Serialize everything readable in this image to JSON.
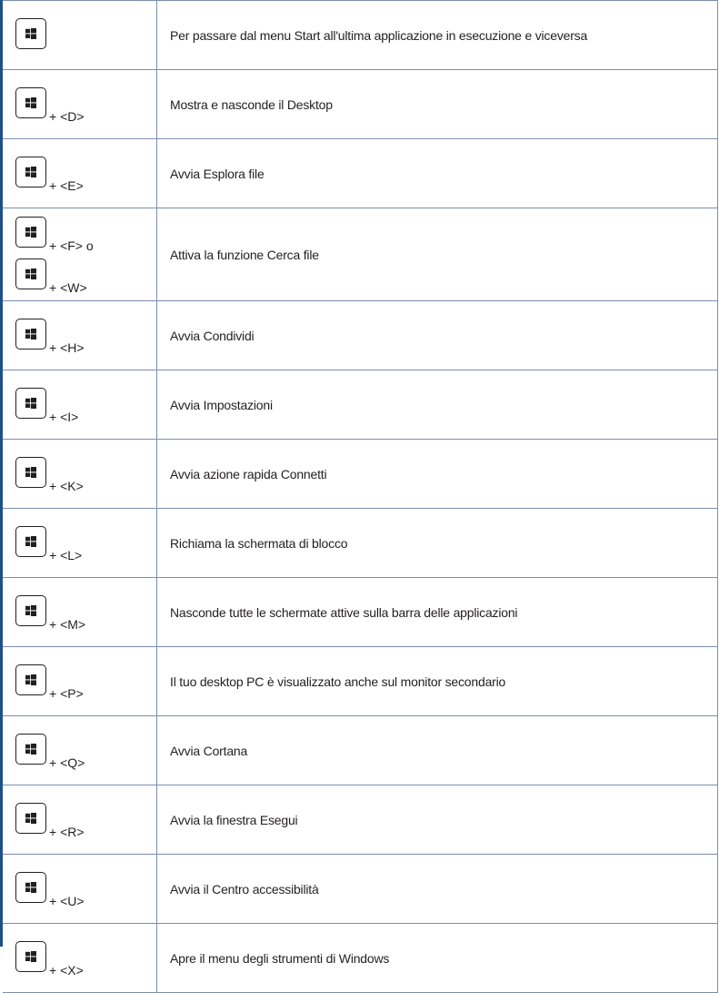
{
  "rows": [
    {
      "keys": [
        ""
      ],
      "description": "Per passare dal menu Start all'ultima applicazione in esecuzione e viceversa"
    },
    {
      "keys": [
        "+ <D>"
      ],
      "description": "Mostra e nasconde il Desktop"
    },
    {
      "keys": [
        "+ <E>"
      ],
      "description": "Avvia Esplora file"
    },
    {
      "keys": [
        "+ <F> o",
        "+ <W>"
      ],
      "description": "Attiva la funzione Cerca file"
    },
    {
      "keys": [
        "+ <H>"
      ],
      "description": "Avvia Condividi"
    },
    {
      "keys": [
        "+ <I>"
      ],
      "description": "Avvia Impostazioni"
    },
    {
      "keys": [
        "+ <K>"
      ],
      "description": "Avvia azione rapida Connetti"
    },
    {
      "keys": [
        "+ <L>"
      ],
      "description": "Richiama la schermata di blocco"
    },
    {
      "keys": [
        "+ <M>"
      ],
      "description": "Nasconde tutte le schermate attive sulla barra delle applicazioni"
    },
    {
      "keys": [
        "+ <P>"
      ],
      "description": "Il tuo desktop PC è visualizzato anche sul monitor secondario"
    },
    {
      "keys": [
        "+ <Q>"
      ],
      "description": "Avvia Cortana"
    },
    {
      "keys": [
        "+ <R>"
      ],
      "description": "Avvia la finestra Esegui"
    },
    {
      "keys": [
        "+ <U>"
      ],
      "description": "Avvia il Centro accessibilità"
    },
    {
      "keys": [
        "+ <X>"
      ],
      "description": "Apre il menu degli strumenti di Windows"
    }
  ],
  "icons": {
    "key_icon": "windows-logo-icon"
  },
  "colors": {
    "border": "#7b8fae",
    "accent_rule": "#1d4f8a",
    "text": "#231f20"
  }
}
